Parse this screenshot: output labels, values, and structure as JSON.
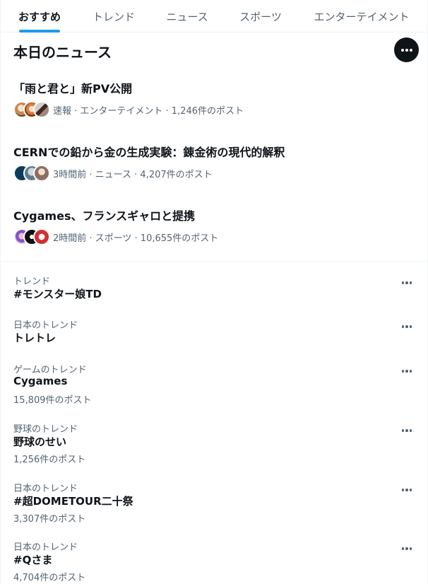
{
  "tabs": [
    {
      "label": "おすすめ",
      "active": true
    },
    {
      "label": "トレンド",
      "active": false
    },
    {
      "label": "ニュース",
      "active": false
    },
    {
      "label": "スポーツ",
      "active": false
    },
    {
      "label": "エンターテイメント",
      "active": false
    }
  ],
  "news": {
    "header": "本日のニュース",
    "more_icon": "more-horizontal-icon",
    "items": [
      {
        "title": "「雨と君と」新PV公開",
        "meta": "速報 · エンターテイメント · 1,246件のポスト"
      },
      {
        "title": "CERNでの鉛から金の生成実験：錬金術の現代的解釈",
        "meta": "3時間前 · ニュース · 4,207件のポスト"
      },
      {
        "title": "Cygames、フランスギャロと提携",
        "meta": "2時間前 · スポーツ · 10,655件のポスト"
      }
    ]
  },
  "trends": [
    {
      "category": "トレンド",
      "name": "#モンスター娘TD",
      "count": ""
    },
    {
      "category": "日本のトレンド",
      "name": "トレトレ",
      "count": ""
    },
    {
      "category": "ゲームのトレンド",
      "name": "Cygames",
      "count": "15,809件のポスト"
    },
    {
      "category": "野球のトレンド",
      "name": "野球のせい",
      "count": "1,256件のポスト"
    },
    {
      "category": "日本のトレンド",
      "name": "#超DOMETOUR二十祭",
      "count": "3,307件のポスト"
    },
    {
      "category": "日本のトレンド",
      "name": "#Qさま",
      "count": "4,704件のポスト"
    }
  ],
  "colors": {
    "accent": "#1d9bf0",
    "text": "#0f1419",
    "secondary": "#536471"
  }
}
